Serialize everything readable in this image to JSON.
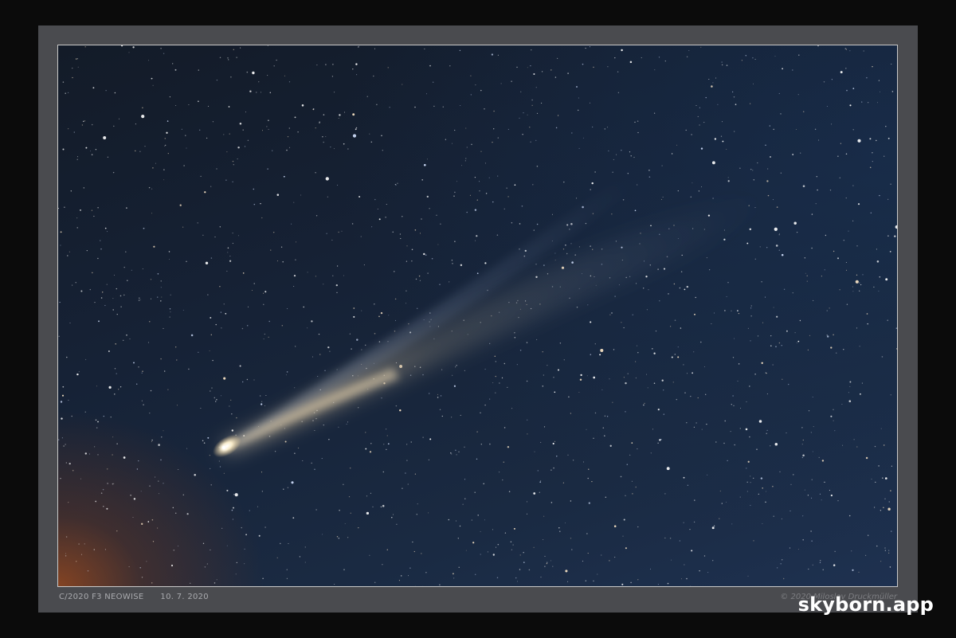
{
  "photo": {
    "subject": "comet",
    "object_designation": "C/2020 F3 NEOWISE",
    "date": "10. 7. 2020",
    "copyright": "© 2020 Miloslav Druckmüller"
  },
  "watermark": {
    "text": "skyborn.app"
  },
  "colors": {
    "frame_outer": "#0b0b0b",
    "mat": "#4a4b4f",
    "sky_top": "#131b28",
    "sky_bottom_right": "#1e3150",
    "horizon_glow": "#96481e",
    "comet_head": "#fff6dc",
    "comet_dust_tail": "#d8c3a0"
  }
}
